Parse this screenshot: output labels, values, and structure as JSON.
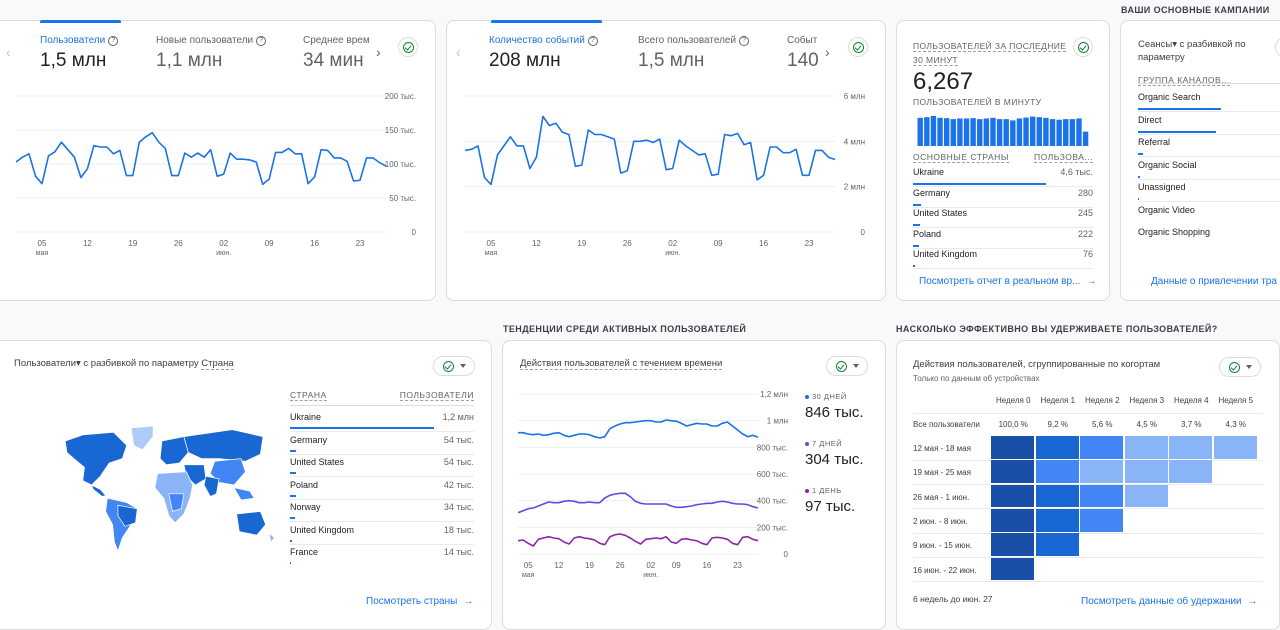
{
  "top_left_card": {
    "kpis": [
      {
        "label": "Пользователи",
        "value": "1,5 млн",
        "active": true
      },
      {
        "label": "Новые пользователи",
        "value": "1,1 млн",
        "active": false
      },
      {
        "label": "Среднее врем",
        "value": "34 мин",
        "active": false
      }
    ],
    "prev_icon": "‹",
    "next_icon": "›",
    "y_ticks": [
      "200 тыс.",
      "150 тыс.",
      "100 тыс.",
      "50 тыс.",
      "0"
    ],
    "x_ticks": [
      "05",
      "12",
      "19",
      "26",
      "02",
      "09",
      "16",
      "23"
    ],
    "x_sub": [
      "мая",
      "",
      "",
      "",
      "июн.",
      "",
      "",
      ""
    ]
  },
  "top_mid_card": {
    "kpis": [
      {
        "label": "Количество событий",
        "value": "208 млн",
        "active": true
      },
      {
        "label": "Всего пользователей",
        "value": "1,5 млн",
        "active": false
      },
      {
        "label": "Событ",
        "value": "140",
        "active": false
      }
    ],
    "prev_icon": "‹",
    "next_icon": "›",
    "y_ticks": [
      "6 млн",
      "4 млн",
      "2 млн",
      "0"
    ],
    "x_ticks": [
      "05",
      "12",
      "19",
      "26",
      "02",
      "09",
      "16",
      "23"
    ],
    "x_sub": [
      "мая",
      "",
      "",
      "",
      "июн.",
      "",
      "",
      ""
    ]
  },
  "realtime_card": {
    "title": "ПОЛЬЗОВАТЕЛЕЙ ЗА ПОСЛЕДНИЕ 30 МИНУТ",
    "value": "6,267",
    "per_minute_label": "ПОЛЬЗОВАТЕЛЕЙ В МИНУТУ",
    "per_minute_values": [
      0.88,
      0.9,
      0.94,
      0.88,
      0.87,
      0.84,
      0.86,
      0.86,
      0.87,
      0.84,
      0.86,
      0.88,
      0.84,
      0.84,
      0.8,
      0.86,
      0.89,
      0.92,
      0.9,
      0.88,
      0.84,
      0.82,
      0.84,
      0.84,
      0.86,
      0.45
    ],
    "col_country": "ОСНОВНЫЕ СТРАНЫ",
    "col_users": "ПОЛЬЗОВА...",
    "rows": [
      {
        "country": "Ukraine",
        "value": "4,6 тыс.",
        "share": 0.74
      },
      {
        "country": "Germany",
        "value": "280",
        "share": 0.045
      },
      {
        "country": "United States",
        "value": "245",
        "share": 0.04
      },
      {
        "country": "Poland",
        "value": "222",
        "share": 0.035
      },
      {
        "country": "United Kingdom",
        "value": "76",
        "share": 0.012
      }
    ],
    "link": "Посмотреть отчет в реальном вр...",
    "link_arrow": "→"
  },
  "campaigns": {
    "section_title": "ВАШИ ОСНОВНЫЕ КАМПАНИИ",
    "title": "Сеансы▾ с разбивкой по параметру",
    "column": "ГРУППА КАНАЛОВ...",
    "rows": [
      {
        "name": "Organic Search",
        "share": 0.52
      },
      {
        "name": "Direct",
        "share": 0.49
      },
      {
        "name": "Referral",
        "share": 0.03
      },
      {
        "name": "Organic Social",
        "share": 0.015
      },
      {
        "name": "Unassigned",
        "share": 0.005
      },
      {
        "name": "Organic Video",
        "share": 0
      },
      {
        "name": "Organic Shopping",
        "share": 0
      }
    ],
    "link": "Данные о привлечении тра"
  },
  "country_card": {
    "title_metric": "Пользователи▾",
    "title_mid": "с разбивкой по параметру",
    "title_dim": "Страна",
    "col_country": "СТРАНА",
    "col_users": "ПОЛЬЗОВАТЕЛИ",
    "rows": [
      {
        "country": "Ukraine",
        "value": "1,2 млн",
        "share": 0.78
      },
      {
        "country": "Germany",
        "value": "54 тыс.",
        "share": 0.035
      },
      {
        "country": "United States",
        "value": "54 тыс.",
        "share": 0.035
      },
      {
        "country": "Poland",
        "value": "42 тыс.",
        "share": 0.03
      },
      {
        "country": "Norway",
        "value": "34 тыс.",
        "share": 0.025
      },
      {
        "country": "United Kingdom",
        "value": "18 тыс.",
        "share": 0.012
      },
      {
        "country": "France",
        "value": "14 тыс.",
        "share": 0.008
      }
    ],
    "link": "Посмотреть страны",
    "link_arrow": "→"
  },
  "active_users": {
    "section_title": "ТЕНДЕНЦИИ СРЕДИ АКТИВНЫХ ПОЛЬЗОВАТЕЛЕЙ",
    "title": "Действия пользователей с течением времени",
    "y_ticks": [
      "1,2 млн",
      "1 млн",
      "800 тыс.",
      "600 тыс.",
      "400 тыс.",
      "200 тыс.",
      "0"
    ],
    "x_ticks": [
      "05",
      "12",
      "19",
      "26",
      "02",
      "09",
      "16",
      "23"
    ],
    "x_sub": [
      "мая",
      "",
      "",
      "",
      "июн.",
      "",
      "",
      ""
    ],
    "legend": [
      {
        "label": "30 ДНЕЙ",
        "value": "846 тыс.",
        "color": "#1a73e8"
      },
      {
        "label": "7 ДНЕЙ",
        "value": "304 тыс.",
        "color": "#5e4ce6"
      },
      {
        "label": "1 ДЕНЬ",
        "value": "97 тыс.",
        "color": "#8e24aa"
      }
    ]
  },
  "retention": {
    "section_title": "НАСКОЛЬКО ЭФФЕКТИВНО ВЫ УДЕРЖИВАЕТЕ ПОЛЬЗОВАТЕЛЕЙ?",
    "title": "Действия пользователей, сгруппированные по когортам",
    "subtitle": "Только по данным об устройствах",
    "weeks": [
      "Неделя 0",
      "Неделя 1",
      "Неделя 2",
      "Неделя 3",
      "Неделя 4",
      "Неделя 5"
    ],
    "all_label": "Все пользователи",
    "all_values": [
      "100,0 %",
      "9,2 %",
      "5,6 %",
      "4,5 %",
      "3,7 %",
      "4,3 %"
    ],
    "cohorts": [
      {
        "label": "12 мая - 18 мая",
        "levels": [
          4,
          3,
          2,
          1,
          1,
          1
        ]
      },
      {
        "label": "19 мая - 25 мая",
        "levels": [
          4,
          2,
          1,
          1,
          1
        ]
      },
      {
        "label": "26 мая - 1 июн.",
        "levels": [
          4,
          3,
          2,
          1
        ]
      },
      {
        "label": "2 июн. - 8 июн.",
        "levels": [
          4,
          3,
          2
        ]
      },
      {
        "label": "9 июн. - 15 июн.",
        "levels": [
          4,
          3
        ]
      },
      {
        "label": "16 июн. - 22 июн.",
        "levels": [
          4
        ]
      }
    ],
    "footer": "6 недель до июн. 27",
    "link": "Посмотреть данные об удержании",
    "link_arrow": "→"
  },
  "chart_data": [
    {
      "type": "line",
      "title": "Пользователи",
      "ylim": [
        0,
        200000
      ],
      "y_ticks": [
        "0",
        "50 тыс.",
        "100 тыс.",
        "150 тыс.",
        "200 тыс."
      ],
      "x_ticks": [
        "05 мая",
        "12",
        "19",
        "26",
        "02 июн.",
        "09",
        "16",
        "23"
      ],
      "series": [
        {
          "name": "Пользователи",
          "values": [
            103,
            110,
            115,
            82,
            71,
            112,
            118,
            132,
            121,
            110,
            80,
            93,
            127,
            125,
            125,
            115,
            120,
            83,
            83,
            132,
            140,
            146,
            132,
            123,
            83,
            83,
            116,
            110,
            116,
            110,
            121,
            82,
            85,
            116,
            107,
            107,
            106,
            103,
            70,
            78,
            117,
            117,
            123,
            115,
            115,
            71,
            81,
            121,
            120,
            109,
            109,
            104,
            75,
            76,
            109,
            109,
            102,
            97
          ]
        }
      ]
    },
    {
      "type": "line",
      "title": "Количество событий",
      "ylim": [
        0,
        6000000
      ],
      "y_ticks": [
        "0",
        "2 млн",
        "4 млн",
        "6 млн"
      ],
      "x_ticks": [
        "05 мая",
        "12",
        "19",
        "26",
        "02 июн.",
        "09",
        "16",
        "23"
      ],
      "series": [
        {
          "name": "Количество событий",
          "values": [
            3.6,
            3.65,
            3.8,
            2.4,
            2.1,
            3.4,
            3.8,
            4.2,
            3.8,
            3.8,
            2.8,
            3.3,
            5.1,
            4.7,
            4.8,
            4.4,
            4.3,
            2.9,
            2.95,
            4.5,
            4.3,
            4.3,
            4.2,
            4.1,
            2.6,
            2.7,
            4.0,
            4.0,
            4.05,
            3.95,
            4.1,
            2.75,
            2.8,
            4.05,
            3.8,
            3.6,
            3.4,
            3.45,
            2.5,
            2.55,
            4.3,
            4.25,
            4.35,
            3.85,
            3.95,
            2.3,
            2.5,
            3.75,
            3.75,
            3.5,
            3.5,
            3.65,
            2.5,
            2.5,
            3.6,
            3.6,
            3.3,
            3.2
          ]
        }
      ]
    },
    {
      "type": "bar",
      "title": "Пользователей в минуту",
      "values": [
        0.88,
        0.9,
        0.94,
        0.88,
        0.87,
        0.84,
        0.86,
        0.86,
        0.87,
        0.84,
        0.86,
        0.88,
        0.84,
        0.84,
        0.8,
        0.86,
        0.89,
        0.92,
        0.9,
        0.88,
        0.84,
        0.82,
        0.84,
        0.84,
        0.86,
        0.45
      ]
    },
    {
      "type": "line",
      "title": "Действия пользователей с течением времени",
      "ylim": [
        0,
        1200000
      ],
      "y_ticks": [
        "0",
        "200 тыс.",
        "400 тыс.",
        "600 тыс.",
        "800 тыс.",
        "1 млн",
        "1,2 млн"
      ],
      "x_ticks": [
        "05 мая",
        "12",
        "19",
        "26",
        "02 июн.",
        "09",
        "16",
        "23"
      ],
      "series": [
        {
          "name": "30 дней",
          "values": [
            910,
            910,
            900,
            895,
            900,
            890,
            895,
            905,
            910,
            890,
            880,
            890,
            900,
            900,
            895,
            880,
            870,
            880,
            940,
            960,
            975,
            985,
            985,
            990,
            995,
            1000,
            1000,
            990,
            990,
            1005,
            1000,
            995,
            980,
            960,
            970,
            980,
            975,
            975,
            960,
            960,
            980,
            990,
            960,
            930,
            900,
            880,
            890,
            875
          ]
        },
        {
          "name": "7 дней",
          "values": [
            310,
            325,
            340,
            345,
            360,
            375,
            390,
            385,
            385,
            395,
            400,
            395,
            385,
            385,
            390,
            385,
            385,
            420,
            440,
            450,
            455,
            455,
            430,
            395,
            380,
            375,
            375,
            375,
            375,
            375,
            360,
            350,
            350,
            355,
            360,
            370,
            375,
            380,
            380,
            390,
            395,
            390,
            380,
            375,
            375,
            370,
            355,
            345
          ]
        },
        {
          "name": "1 день",
          "values": [
            100,
            105,
            80,
            60,
            110,
            120,
            130,
            120,
            115,
            90,
            75,
            120,
            130,
            120,
            115,
            105,
            80,
            70,
            130,
            145,
            150,
            140,
            120,
            95,
            75,
            110,
            115,
            120,
            115,
            130,
            90,
            80,
            110,
            115,
            105,
            100,
            80,
            70,
            120,
            125,
            120,
            110,
            80,
            70,
            125,
            130,
            110,
            100
          ]
        }
      ]
    },
    {
      "type": "heatmap",
      "title": "Действия пользователей, сгруппированные по когортам",
      "columns": [
        "Неделя 0",
        "Неделя 1",
        "Неделя 2",
        "Неделя 3",
        "Неделя 4",
        "Неделя 5"
      ],
      "rows": [
        "12 мая - 18 мая",
        "19 мая - 25 мая",
        "26 мая - 1 июн.",
        "2 июн. - 8 июн.",
        "9 июн. - 15 июн.",
        "16 июн. - 22 июн."
      ],
      "summary_row": {
        "label": "Все пользователи",
        "values": [
          100.0,
          9.2,
          5.6,
          4.5,
          3.7,
          4.3
        ]
      }
    }
  ]
}
